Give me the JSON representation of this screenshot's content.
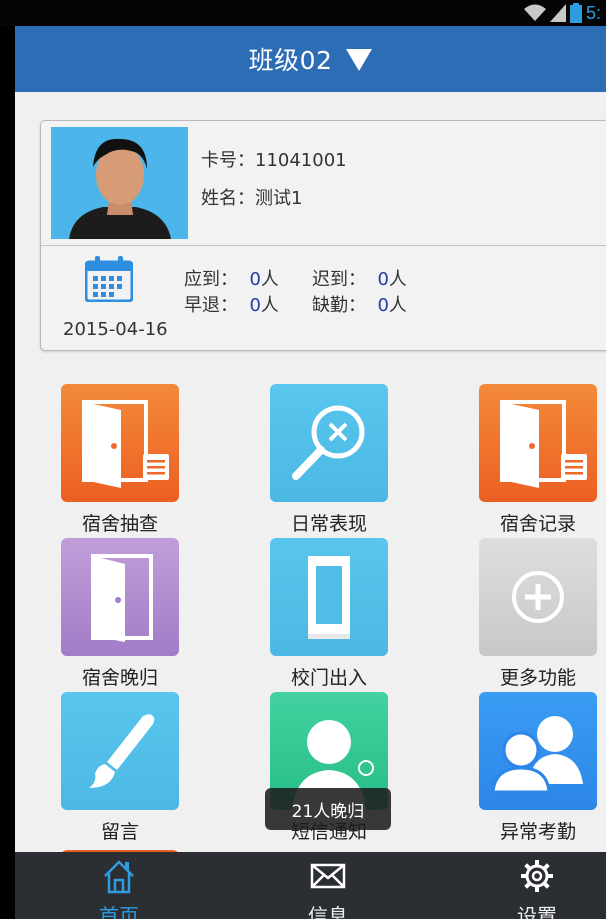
{
  "status_bar": {
    "time": "5:",
    "icons": [
      "wifi-icon",
      "signal-icon",
      "battery-icon"
    ]
  },
  "header": {
    "title": "班级02",
    "dropdown_icon": "triangle-down-icon"
  },
  "student_card": {
    "card_label": "卡号：",
    "card_number": "11041001",
    "name_label": "姓名：",
    "name": "测试1",
    "date": "2015-04-16",
    "stats": [
      {
        "label": "应到：",
        "value": "0",
        "unit": "人"
      },
      {
        "label": "迟到：",
        "value": "0",
        "unit": "人"
      },
      {
        "label": "早退：",
        "value": "0",
        "unit": "人"
      },
      {
        "label": "缺勤：",
        "value": "0",
        "unit": "人"
      }
    ]
  },
  "menu": [
    {
      "label": "宿舍抽查",
      "icon": "door-checklist-icon",
      "color": "#ec6a2a"
    },
    {
      "label": "日常表现",
      "icon": "magnifier-icon",
      "color": "#4fbde7"
    },
    {
      "label": "宿舍记录",
      "icon": "door-checklist-icon",
      "color": "#ec6a2a"
    },
    {
      "label": "宿舍晚归",
      "icon": "door-open-icon",
      "color": "#b08ed0"
    },
    {
      "label": "校门出入",
      "icon": "gate-icon",
      "color": "#4fbde7"
    },
    {
      "label": "更多功能",
      "icon": "plus-circle-icon",
      "color": "#d3d3d3"
    },
    {
      "label": "留言",
      "icon": "brush-icon",
      "color": "#4fbde7"
    },
    {
      "label": "短信通知",
      "icon": "user-alarm-icon",
      "color": "#33c893"
    },
    {
      "label": "异常考勤",
      "icon": "users-icon",
      "color": "#3393ee"
    }
  ],
  "toast": {
    "text": "21人晚归"
  },
  "bottom_nav": [
    {
      "label": "首页",
      "icon": "home-icon",
      "active": true
    },
    {
      "label": "信息",
      "icon": "mail-icon",
      "active": false
    },
    {
      "label": "设置",
      "icon": "gear-icon",
      "active": false
    }
  ],
  "colors": {
    "header": "#2d6db5",
    "accent": "#2e9de0",
    "stat_number": "#1f3fa6",
    "nav_background": "#2b2e33"
  }
}
